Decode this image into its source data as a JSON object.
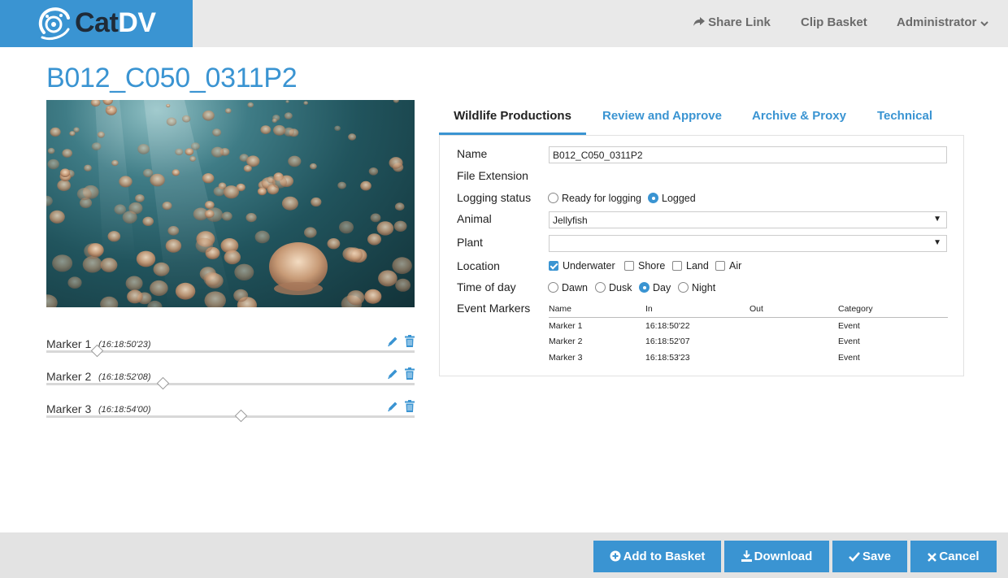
{
  "header": {
    "logo_prefix": "Cat",
    "logo_suffix": "DV",
    "nav": {
      "share": "Share Link",
      "basket": "Clip Basket",
      "admin": "Administrator"
    }
  },
  "clip": {
    "title": "B012_C050_0311P2"
  },
  "markers": [
    {
      "label": "Marker 1",
      "time": "(16:18:50'23)",
      "position": 0.14
    },
    {
      "label": "Marker 2",
      "time": "(16:18:52'08)",
      "position": 0.318
    },
    {
      "label": "Marker 3",
      "time": "(16:18:54'00)",
      "position": 0.53
    }
  ],
  "tabs": [
    {
      "label": "Wildlife Productions",
      "active": true
    },
    {
      "label": "Review and Approve",
      "active": false
    },
    {
      "label": "Archive & Proxy",
      "active": false
    },
    {
      "label": "Technical",
      "active": false
    }
  ],
  "form": {
    "name_label": "Name",
    "name_value": "B012_C050_0311P2",
    "ext_label": "File Extension",
    "status_label": "Logging status",
    "status_options": [
      "Ready for logging",
      "Logged"
    ],
    "status_selected": "Logged",
    "animal_label": "Animal",
    "animal_value": "Jellyfish",
    "plant_label": "Plant",
    "plant_value": "",
    "location_label": "Location",
    "location_options": [
      "Underwater",
      "Shore",
      "Land",
      "Air"
    ],
    "location_checked": [
      "Underwater"
    ],
    "time_label": "Time of day",
    "time_options": [
      "Dawn",
      "Dusk",
      "Day",
      "Night"
    ],
    "time_selected": "Day",
    "events_label": "Event Markers",
    "events_columns": [
      "Name",
      "In",
      "Out",
      "Category"
    ],
    "events_rows": [
      [
        "Marker 1",
        "16:18:50'22",
        "",
        "Event"
      ],
      [
        "Marker 2",
        "16:18:52'07",
        "",
        "Event"
      ],
      [
        "Marker 3",
        "16:18:53'23",
        "",
        "Event"
      ]
    ]
  },
  "footer": {
    "add_basket": "Add to Basket",
    "download": "Download",
    "save": "Save",
    "cancel": "Cancel"
  },
  "colors": {
    "accent": "#3a94d2",
    "header_bg": "#e9e9e9",
    "footer_bg": "#e3e3e3"
  }
}
